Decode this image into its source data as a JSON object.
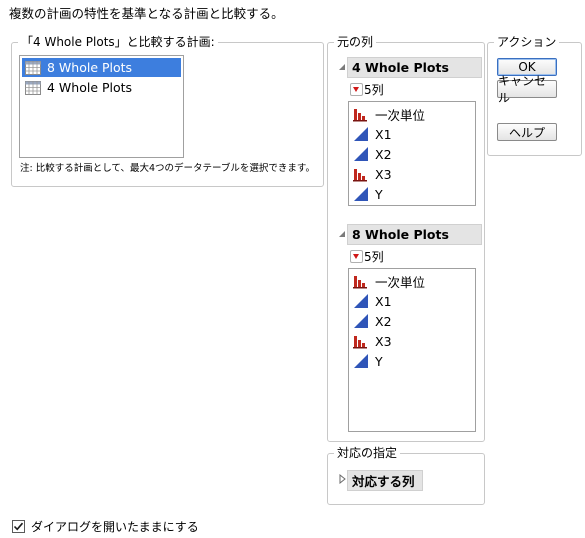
{
  "header": {
    "description": "複数の計画の特性を基準となる計画と比較する。"
  },
  "compare_panel": {
    "title": "「4 Whole Plots」と比較する計画:",
    "designs": [
      {
        "label": "8 Whole Plots",
        "selected": true
      },
      {
        "label": "4 Whole Plots",
        "selected": false
      }
    ],
    "note": "注: 比較する計画として、最大4つのデータテーブルを選択できます。"
  },
  "source_panel": {
    "title": "元の列",
    "tables": [
      {
        "name": "4 Whole Plots",
        "count_label": "5列",
        "columns": [
          {
            "name": "一次単位",
            "icon": "nominal-bar-icon"
          },
          {
            "name": "X1",
            "icon": "continuous-triangle-icon"
          },
          {
            "name": "X2",
            "icon": "continuous-triangle-icon"
          },
          {
            "name": "X3",
            "icon": "nominal-bar-icon"
          },
          {
            "name": "Y",
            "icon": "continuous-triangle-icon"
          }
        ]
      },
      {
        "name": "8 Whole Plots",
        "count_label": "5列",
        "columns": [
          {
            "name": "一次単位",
            "icon": "nominal-bar-icon"
          },
          {
            "name": "X1",
            "icon": "continuous-triangle-icon"
          },
          {
            "name": "X2",
            "icon": "continuous-triangle-icon"
          },
          {
            "name": "X3",
            "icon": "nominal-bar-icon"
          },
          {
            "name": "Y",
            "icon": "continuous-triangle-icon"
          }
        ]
      }
    ]
  },
  "match_panel": {
    "title": "対応の指定",
    "button_label": "対応する列"
  },
  "action_panel": {
    "title": "アクション",
    "ok_label": "OK",
    "cancel_label": "キャンセル",
    "help_label": "ヘルプ"
  },
  "footer": {
    "keep_open_label": "ダイアログを開いたままにする",
    "keep_open_checked": true
  },
  "colors": {
    "selection": "#3d7ede",
    "nominal": "#c0281e",
    "continuous": "#2f55b8"
  }
}
